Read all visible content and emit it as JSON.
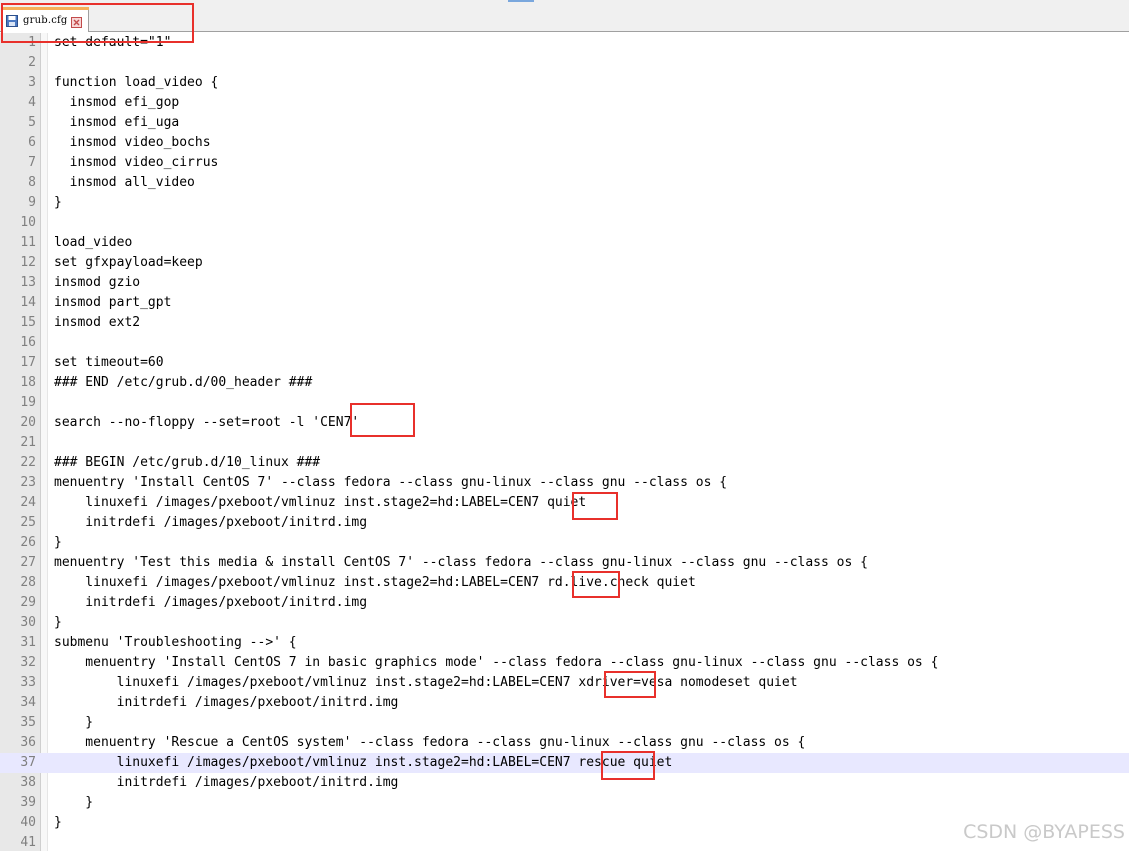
{
  "tab": {
    "label": "grub.cfg"
  },
  "lines": [
    {
      "n": "1",
      "text": "set default=\"1\""
    },
    {
      "n": "2",
      "text": ""
    },
    {
      "n": "3",
      "text": "function load_video {"
    },
    {
      "n": "4",
      "text": "  insmod efi_gop"
    },
    {
      "n": "5",
      "text": "  insmod efi_uga"
    },
    {
      "n": "6",
      "text": "  insmod video_bochs"
    },
    {
      "n": "7",
      "text": "  insmod video_cirrus"
    },
    {
      "n": "8",
      "text": "  insmod all_video"
    },
    {
      "n": "9",
      "text": "}"
    },
    {
      "n": "10",
      "text": ""
    },
    {
      "n": "11",
      "text": "load_video"
    },
    {
      "n": "12",
      "text": "set gfxpayload=keep"
    },
    {
      "n": "13",
      "text": "insmod gzio"
    },
    {
      "n": "14",
      "text": "insmod part_gpt"
    },
    {
      "n": "15",
      "text": "insmod ext2"
    },
    {
      "n": "16",
      "text": ""
    },
    {
      "n": "17",
      "text": "set timeout=60"
    },
    {
      "n": "18",
      "text": "### END /etc/grub.d/00_header ###"
    },
    {
      "n": "19",
      "text": ""
    },
    {
      "n": "20",
      "text": "search --no-floppy --set=root -l 'CEN7'"
    },
    {
      "n": "21",
      "text": ""
    },
    {
      "n": "22",
      "text": "### BEGIN /etc/grub.d/10_linux ###"
    },
    {
      "n": "23",
      "text": "menuentry 'Install CentOS 7' --class fedora --class gnu-linux --class gnu --class os {"
    },
    {
      "n": "24",
      "text": "    linuxefi /images/pxeboot/vmlinuz inst.stage2=hd:LABEL=CEN7 quiet"
    },
    {
      "n": "25",
      "text": "    initrdefi /images/pxeboot/initrd.img"
    },
    {
      "n": "26",
      "text": "}"
    },
    {
      "n": "27",
      "text": "menuentry 'Test this media & install CentOS 7' --class fedora --class gnu-linux --class gnu --class os {"
    },
    {
      "n": "28",
      "text": "    linuxefi /images/pxeboot/vmlinuz inst.stage2=hd:LABEL=CEN7 rd.live.check quiet"
    },
    {
      "n": "29",
      "text": "    initrdefi /images/pxeboot/initrd.img"
    },
    {
      "n": "30",
      "text": "}"
    },
    {
      "n": "31",
      "text": "submenu 'Troubleshooting -->' {"
    },
    {
      "n": "32",
      "text": "    menuentry 'Install CentOS 7 in basic graphics mode' --class fedora --class gnu-linux --class gnu --class os {"
    },
    {
      "n": "33",
      "text": "        linuxefi /images/pxeboot/vmlinuz inst.stage2=hd:LABEL=CEN7 xdriver=vesa nomodeset quiet"
    },
    {
      "n": "34",
      "text": "        initrdefi /images/pxeboot/initrd.img"
    },
    {
      "n": "35",
      "text": "    }"
    },
    {
      "n": "36",
      "text": "    menuentry 'Rescue a CentOS system' --class fedora --class gnu-linux --class gnu --class os {"
    },
    {
      "n": "37",
      "text": "        linuxefi /images/pxeboot/vmlinuz inst.stage2=hd:LABEL=CEN7 rescue quiet"
    },
    {
      "n": "38",
      "text": "        initrdefi /images/pxeboot/initrd.img"
    },
    {
      "n": "39",
      "text": "    }"
    },
    {
      "n": "40",
      "text": "}"
    },
    {
      "n": "41",
      "text": ""
    }
  ],
  "active_line": "37",
  "watermark": "CSDN @BYAPESS",
  "colors": {
    "highlight_box": "#e8302b",
    "active_line_bg": "#e8e8ff",
    "gutter_bg": "#e8e8e8",
    "tab_accent": "#f5b05a",
    "watermark": "#c9c9c9"
  }
}
